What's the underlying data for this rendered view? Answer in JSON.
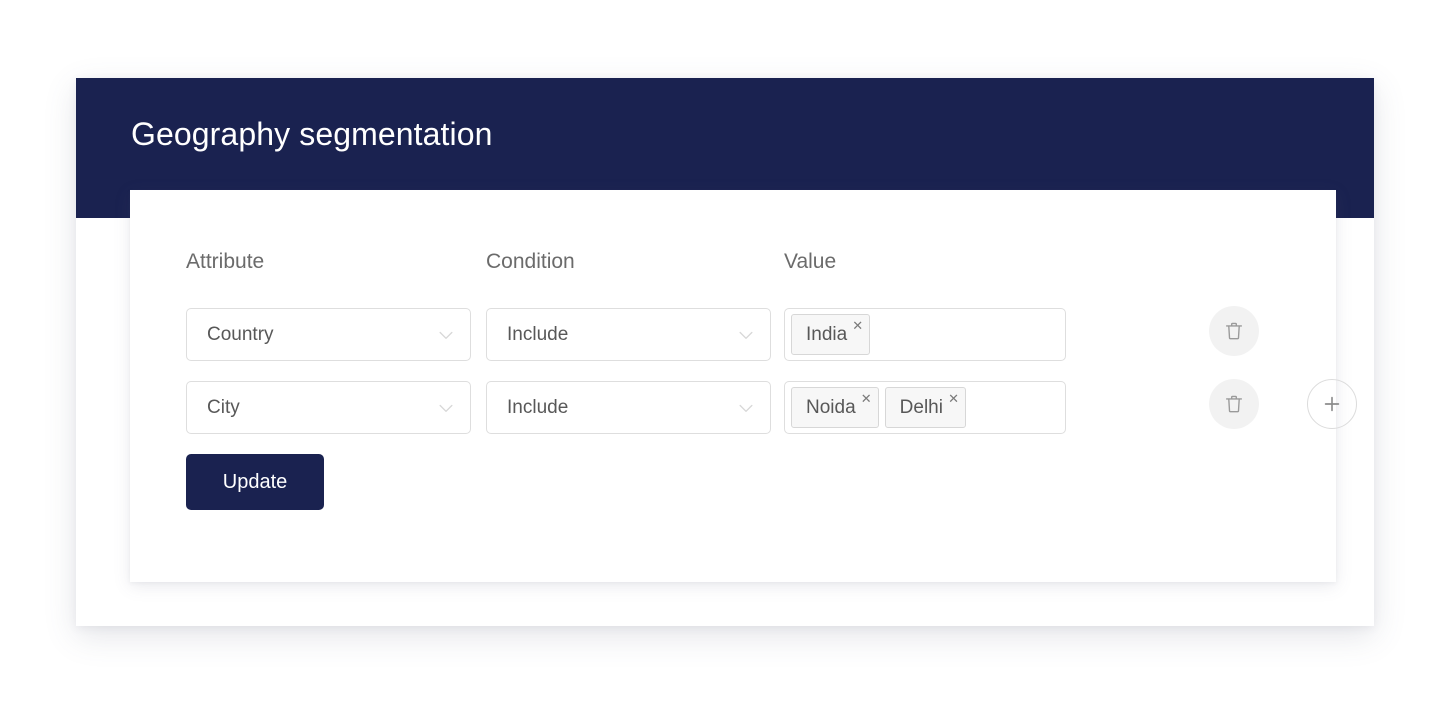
{
  "header": {
    "title": "Geography segmentation",
    "background_color": "#1a2250"
  },
  "table": {
    "columns": {
      "attribute": "Attribute",
      "condition": "Condition",
      "value": "Value"
    },
    "rows": [
      {
        "attribute": "Country",
        "condition": "Include",
        "values": [
          "India"
        ],
        "delete_icon": "trash-icon",
        "remove_chip_icon": "close-icon"
      },
      {
        "attribute": "City",
        "condition": "Include",
        "values": [
          "Noida",
          "Delhi"
        ],
        "delete_icon": "trash-icon",
        "remove_chip_icon": "close-icon"
      }
    ],
    "add_row_icon": "plus-icon",
    "dropdown_icon": "chevron-down-icon"
  },
  "actions": {
    "update_label": "Update",
    "update_color": "#1a2250"
  },
  "colors": {
    "navy": "#1a2250",
    "field_border": "#dedede",
    "chip_background": "#f7f7f7",
    "text_gray": "#585858",
    "header_gray": "#6b6b6b"
  }
}
